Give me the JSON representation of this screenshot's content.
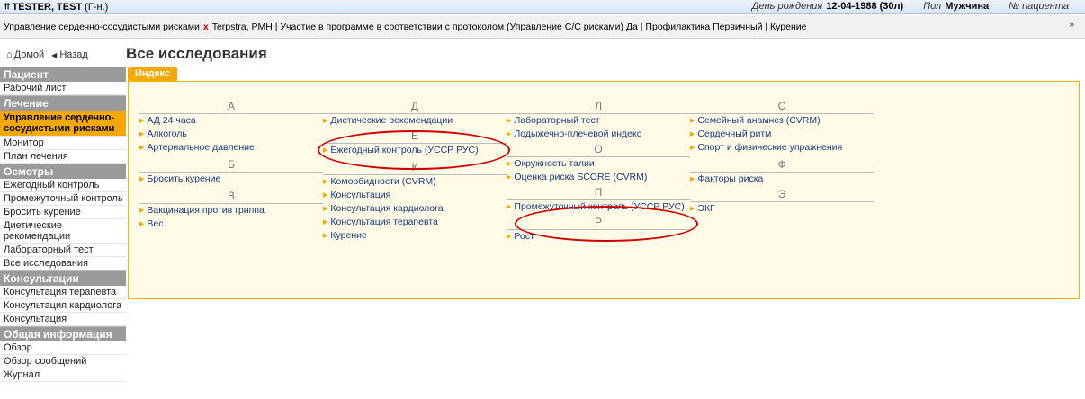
{
  "header": {
    "patient_name": "TESTER, TEST",
    "patient_gender_short": "(Г-н.)",
    "birthday_label": "День рождения",
    "birthday_value": "12-04-1988 (30л)",
    "sex_label": "Пол",
    "sex_value": "Мужчина",
    "patient_no_label": "№ пациента"
  },
  "program": {
    "prefix": "Управление сердечно-сосудистыми рисками",
    "remove_symbol": "x",
    "rest": "Terpstra, PMH | Участие в программе в соответствии с протоколом (Управление С/С рисками) Да | Профилактика Первичный | Курение",
    "collapse_symbol": "»"
  },
  "nav": {
    "home_label": "Домой",
    "back_label": "Назад",
    "page_title": "Все исследования"
  },
  "sidebar": {
    "sections": [
      {
        "title": "Пациент",
        "items": [
          "Рабочий лист"
        ]
      },
      {
        "title": "Лечение",
        "items": [
          "Управление сердечно-сосудистыми рисками",
          "Монитор",
          "План лечения"
        ]
      },
      {
        "title": "Осмотры",
        "items": [
          "Ежегодный контроль",
          "Промежуточный контроль",
          "Бросить курение",
          "Диетические рекомендации",
          "Лабораторный тест",
          "Все исследования"
        ]
      },
      {
        "title": "Консультации",
        "items": [
          "Консультация терапевта",
          "Консультация кардиолога",
          "Консультация"
        ]
      },
      {
        "title": "Общая информация",
        "items": [
          "Обзор",
          "Обзор сообщений",
          "Журнал"
        ]
      }
    ]
  },
  "main": {
    "tab_label": "Индекс",
    "columns": [
      {
        "groups": [
          {
            "letter": "А",
            "items": [
              "АД 24 часа",
              "Алкоголь",
              "Артериальное давление"
            ]
          },
          {
            "letter": "Б",
            "items": [
              "Бросить курение"
            ]
          },
          {
            "letter": "В",
            "items": [
              "Вакцинация против гриппа",
              "Вес"
            ]
          }
        ]
      },
      {
        "groups": [
          {
            "letter": "Д",
            "items": [
              "Диетические рекомендации"
            ]
          },
          {
            "letter": "Е",
            "items": [
              "Ежегодный контроль (УССР РУС)"
            ]
          },
          {
            "letter": "К",
            "items": [
              "Коморбидности (CVRM)",
              "Консультация",
              "Консультация кардиолога",
              "Консультация терапевта",
              "Курение"
            ]
          }
        ]
      },
      {
        "groups": [
          {
            "letter": "Л",
            "items": [
              "Лабораторный тест",
              "Лодыжечно-плечевой индекс"
            ]
          },
          {
            "letter": "О",
            "items": [
              "Окружность талии",
              "Оценка риска SCORE (CVRM)"
            ]
          },
          {
            "letter": "П",
            "items": [
              "Промежуточный контроль (УССР РУС)"
            ]
          },
          {
            "letter": "Р",
            "items": [
              "Рост"
            ]
          }
        ]
      },
      {
        "groups": [
          {
            "letter": "С",
            "items": [
              "Семейный анамнез (CVRM)",
              "Сердечный ритм",
              "Спорт и физические упражнения"
            ]
          },
          {
            "letter": "Ф",
            "items": [
              "Факторы риска"
            ]
          },
          {
            "letter": "Э",
            "items": [
              "ЭКГ"
            ]
          }
        ]
      }
    ]
  },
  "colors": {
    "accent": "#f5a800",
    "link": "#1a3a80",
    "annotation": "#d00000"
  }
}
